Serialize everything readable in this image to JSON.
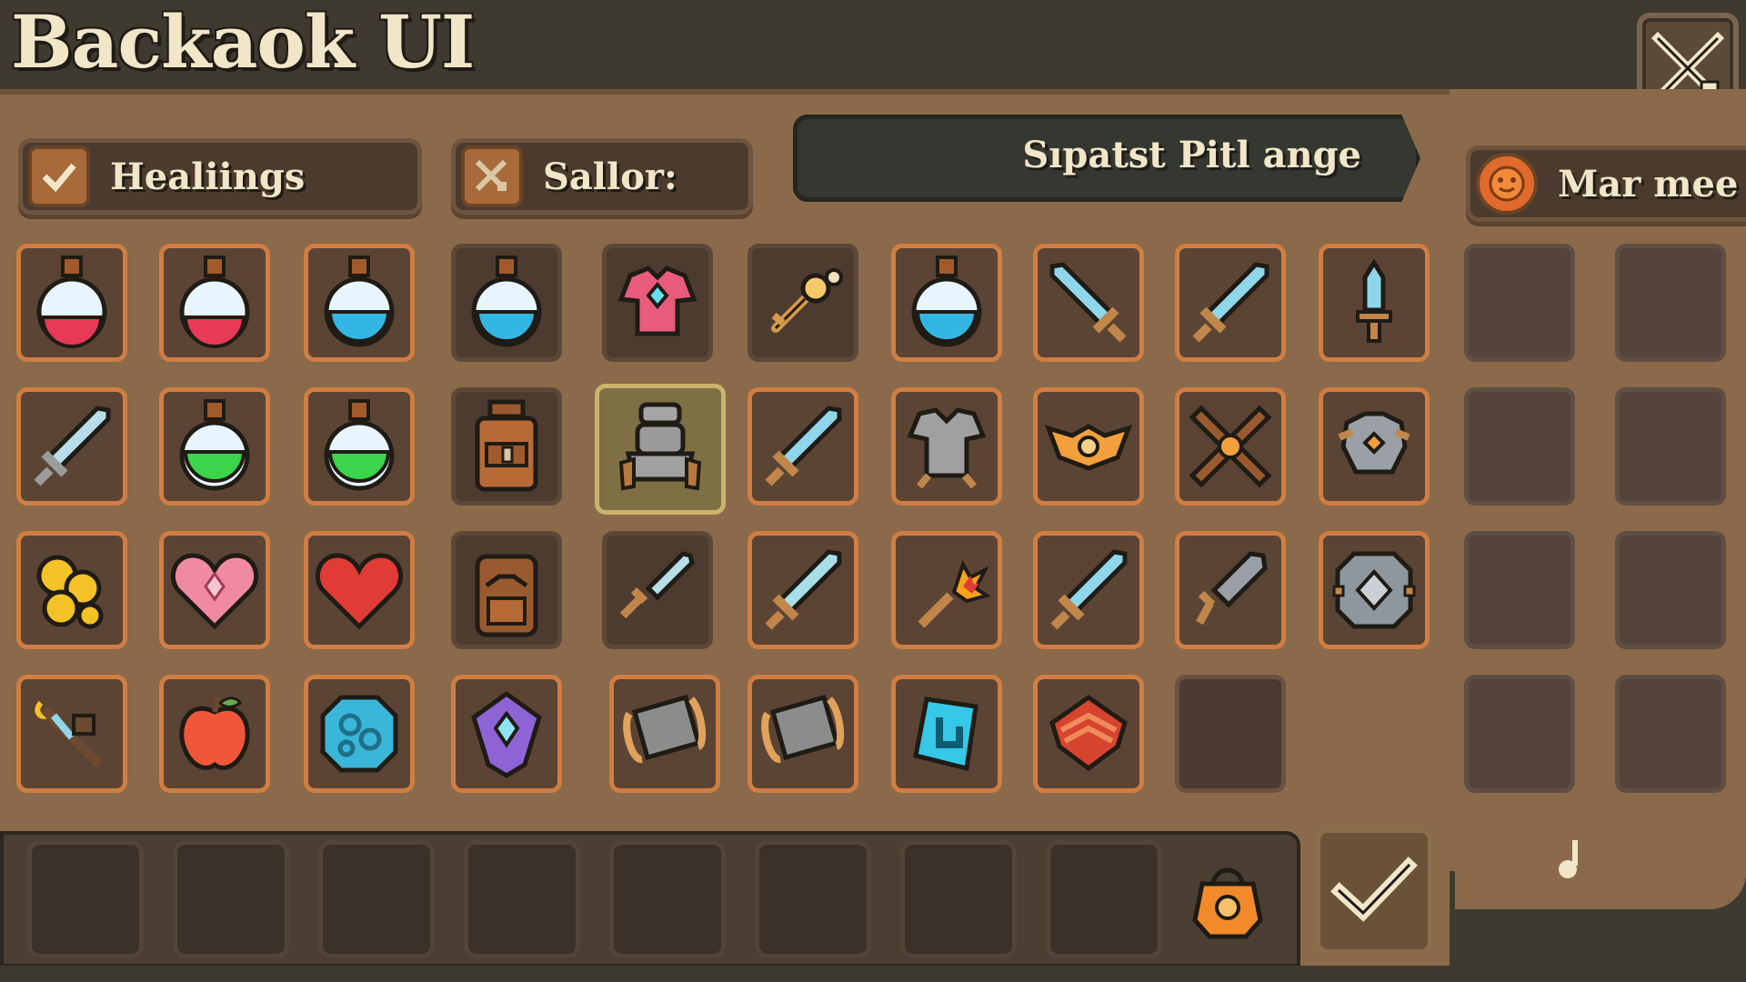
{
  "header": {
    "title": "Backaok UI"
  },
  "filters": {
    "healings_label": "Healiings",
    "sallor_label": "Sallor:",
    "search_text": "Sıpatst Pitl ange",
    "mar_label": "Mar mee"
  },
  "inventory": {
    "rows": [
      [
        "red-potion",
        "red-potion",
        "blue-potion",
        "blue-potion",
        "pink-armor",
        "key",
        "blue-potion",
        "sword",
        "sword",
        "dagger"
      ],
      [
        "sword",
        "green-potion",
        "green-potion",
        "backpack",
        "robot-armor",
        "sword",
        "armor",
        "amulet",
        "crossed-swords",
        "armor"
      ],
      [
        "gold-coins",
        "heart",
        "red-heart",
        "backpack",
        "dagger",
        "sword",
        "fire-torch",
        "sword",
        "gray-sword",
        "shield"
      ],
      [
        "staff",
        "apple",
        "blue-orb",
        "purple-gem",
        "scroll",
        "scroll",
        "blue-rune",
        "red-armor",
        "empty"
      ]
    ],
    "selected": "robot-armor"
  },
  "colors": {
    "accent_orange": "#d17e42",
    "panel_brown": "#8a6a4a",
    "slot_dark": "#5b4434",
    "text_cream": "#f1e6c8"
  }
}
